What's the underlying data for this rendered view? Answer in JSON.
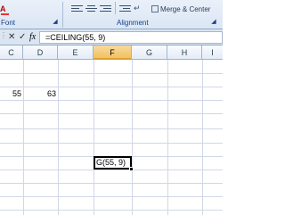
{
  "ribbon": {
    "font_group_label": "Font",
    "alignment_group_label": "Alignment",
    "merge_center_label": "Merge & Center"
  },
  "formula_bar": {
    "cancel_symbol": "✕",
    "enter_symbol": "✓",
    "fx_label": "fx",
    "formula": "=CEILING(55, 9)"
  },
  "columns": [
    "C",
    "D",
    "E",
    "F",
    "G",
    "H",
    "I"
  ],
  "active_column": "F",
  "cells": {
    "c_value": "55",
    "d_value": "63",
    "active_cell_text": "G(55, 9)"
  }
}
